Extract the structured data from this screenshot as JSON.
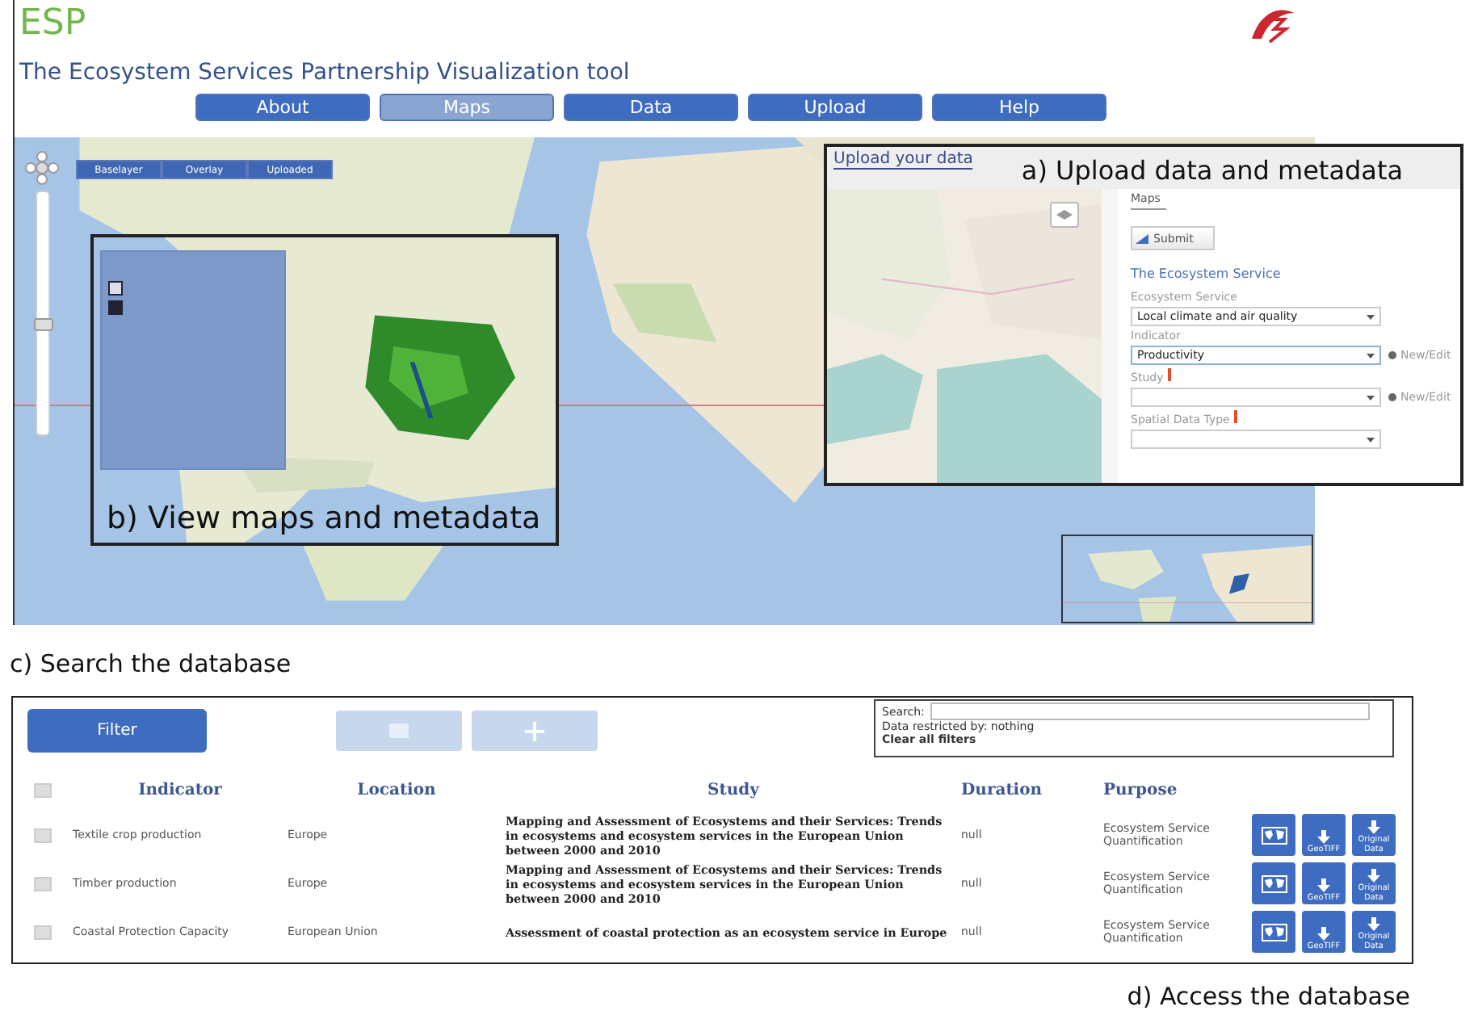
{
  "header": {
    "logo": "ESP",
    "title": "The Ecosystem Services Partnership Visualization tool"
  },
  "nav": [
    {
      "label": "About",
      "selected": false
    },
    {
      "label": "Maps",
      "selected": true
    },
    {
      "label": "Data",
      "selected": false
    },
    {
      "label": "Upload",
      "selected": false
    },
    {
      "label": "Help",
      "selected": false
    }
  ],
  "map": {
    "layer_tabs": [
      "Baselayer",
      "Overlay",
      "Uploaded"
    ],
    "zoom": {
      "level": 0.45
    }
  },
  "inset_b": {
    "caption": "b) View maps and metadata",
    "layers": [
      {
        "checked": false
      },
      {
        "checked": true
      }
    ]
  },
  "upload_panel": {
    "link": "Upload your data",
    "caption": "a) Upload data and metadata",
    "tabs": [
      {
        "label": "Maps",
        "selected": true
      }
    ],
    "submit": "Submit",
    "section": "The Ecosystem Service",
    "fields": [
      {
        "label": "Ecosystem Service",
        "required": false,
        "focused": false,
        "value": "Local climate and air quality"
      },
      {
        "label": "Indicator",
        "required": false,
        "focused": true,
        "value": "Productivity",
        "action": "New/Edit"
      },
      {
        "label": "Study",
        "required": true,
        "focused": false,
        "action": "New/Edit"
      },
      {
        "label": "Spatial Data Type",
        "required": true,
        "focused": false
      }
    ]
  },
  "captions": {
    "search": "c) Search the database",
    "access": "d) Access the database"
  },
  "database": {
    "select_all_checked": false,
    "filter": "Filter",
    "search_label": "Search:",
    "restriction": "Data restricted by: nothing",
    "clear": "Clear all filters",
    "columns": [
      "Indicator",
      "Location",
      "Study",
      "Duration",
      "Purpose"
    ],
    "rows": [
      {
        "selected": false,
        "indicator": "Textile crop production",
        "location": "Europe",
        "study": "Mapping and Assessment of Ecosystems and their Services: Trends in ecosystems and ecosystem services in the European Union between 2000 and 2010",
        "duration": "null",
        "purpose": "Ecosystem Service Quantification",
        "actions": [
          "GeoTIFF",
          "Original Data"
        ]
      },
      {
        "selected": false,
        "indicator": "Timber production",
        "location": "Europe",
        "study": "Mapping and Assessment of Ecosystems and their Services: Trends in ecosystems and ecosystem services in the European Union between 2000 and 2010",
        "duration": "null",
        "purpose": "Ecosystem Service Quantification",
        "actions": [
          "GeoTIFF",
          "Original Data"
        ]
      },
      {
        "selected": false,
        "indicator": "Coastal Protection Capacity",
        "location": "European Union",
        "study": "Assessment of coastal protection as an ecosystem service in Europe",
        "duration": "null",
        "purpose": "Ecosystem Service Quantification",
        "actions": [
          "GeoTIFF",
          "Original Data"
        ]
      }
    ]
  }
}
